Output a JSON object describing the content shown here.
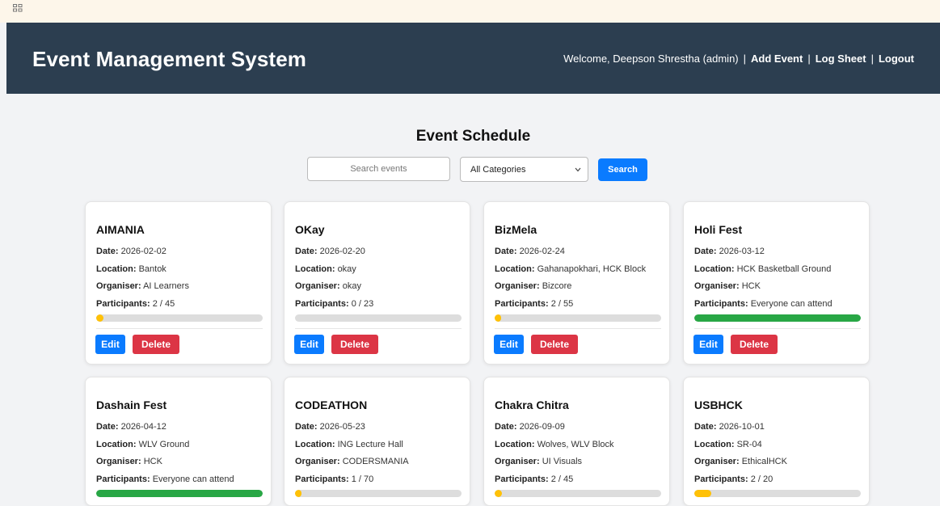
{
  "header": {
    "brand": "Event Management System",
    "welcome": "Welcome, Deepson Shrestha (admin)",
    "links": [
      "Add Event",
      "Log Sheet",
      "Logout"
    ]
  },
  "main": {
    "title": "Event Schedule",
    "search": {
      "placeholder": "Search events",
      "category": "All Categories",
      "button": "Search"
    },
    "labels": {
      "date": "Date:",
      "location": "Location:",
      "organiser": "Organiser:",
      "participants": "Participants:",
      "edit": "Edit",
      "delete": "Delete"
    },
    "events": [
      {
        "name": "AIMANIA",
        "date": "2026-02-02",
        "location": "Bantok",
        "organiser": "AI Learners",
        "participants": "2 / 45",
        "fill": 0.044,
        "color": "#ffc107"
      },
      {
        "name": "OKay",
        "date": "2026-02-20",
        "location": "okay",
        "organiser": "okay",
        "participants": "0 / 23",
        "fill": 0,
        "color": "#ffc107"
      },
      {
        "name": "BizMela",
        "date": "2026-02-24",
        "location": "Gahanapokhari, HCK Block",
        "organiser": "Bizcore",
        "participants": "2 / 55",
        "fill": 0.036,
        "color": "#ffc107"
      },
      {
        "name": "Holi Fest",
        "date": "2026-03-12",
        "location": "HCK Basketball Ground",
        "organiser": "HCK",
        "participants": "Everyone can attend",
        "fill": 1,
        "color": "#28a745"
      },
      {
        "name": "Dashain Fest",
        "date": "2026-04-12",
        "location": "WLV Ground",
        "organiser": "HCK",
        "participants": "Everyone can attend",
        "fill": 1,
        "color": "#28a745"
      },
      {
        "name": "CODEATHON",
        "date": "2026-05-23",
        "location": "ING Lecture Hall",
        "organiser": "CODERSMANIA",
        "participants": "1 / 70",
        "fill": 0.014,
        "color": "#ffc107"
      },
      {
        "name": "Chakra Chitra",
        "date": "2026-09-09",
        "location": "Wolves, WLV Block",
        "organiser": "UI Visuals",
        "participants": "2 / 45",
        "fill": 0.044,
        "color": "#ffc107"
      },
      {
        "name": "USBHCK",
        "date": "2026-10-01",
        "location": "SR-04",
        "organiser": "EthicalHCK",
        "participants": "2 / 20",
        "fill": 0.1,
        "color": "#ffc107"
      }
    ]
  }
}
